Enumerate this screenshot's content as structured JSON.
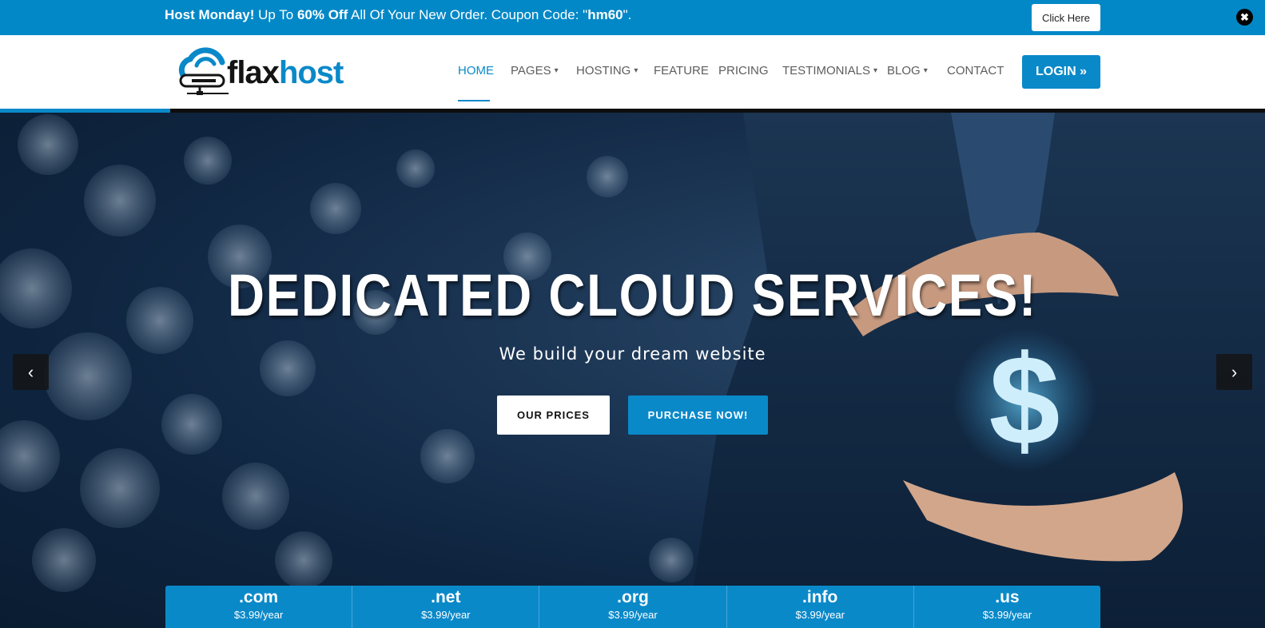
{
  "promo": {
    "lead": "Host Monday!",
    "text1": " Up To ",
    "discount": "60% Off",
    "text2": " All Of Your New Order. Coupon Code: \"",
    "code": "hm60",
    "text3": "\".",
    "button_label": "Click Here",
    "close_icon": "close-icon"
  },
  "logo": {
    "part1": "flax",
    "part2": "host"
  },
  "nav": {
    "items": [
      {
        "label": "HOME",
        "active": true,
        "dropdown": false
      },
      {
        "label": "PAGES",
        "active": false,
        "dropdown": true
      },
      {
        "label": "HOSTING",
        "active": false,
        "dropdown": true
      },
      {
        "label": "FEATURE",
        "active": false,
        "dropdown": false
      },
      {
        "label": "PRICING",
        "active": false,
        "dropdown": false
      },
      {
        "label": "TESTIMONIALS",
        "active": false,
        "dropdown": true
      },
      {
        "label": "BLOG",
        "active": false,
        "dropdown": true
      },
      {
        "label": "CONTACT",
        "active": false,
        "dropdown": false
      }
    ],
    "login_label": "LOGIN"
  },
  "hero": {
    "title": "DEDICATED CLOUD SERVICES!",
    "subtitle": "We build your dream website",
    "btn_prices": "OUR PRICES",
    "btn_purchase": "PURCHASE NOW!",
    "prev_icon": "chevron-left-icon",
    "next_icon": "chevron-right-icon"
  },
  "domains": [
    {
      "ext": ".com",
      "price": "$3.99/year"
    },
    {
      "ext": ".net",
      "price": "$3.99/year"
    },
    {
      "ext": ".org",
      "price": "$3.99/year"
    },
    {
      "ext": ".info",
      "price": "$3.99/year"
    },
    {
      "ext": ".us",
      "price": "$3.99/year"
    }
  ],
  "colors": {
    "accent": "#0a89c9",
    "promo_bg": "#0388c7",
    "hero_dark": "#0f2540"
  }
}
